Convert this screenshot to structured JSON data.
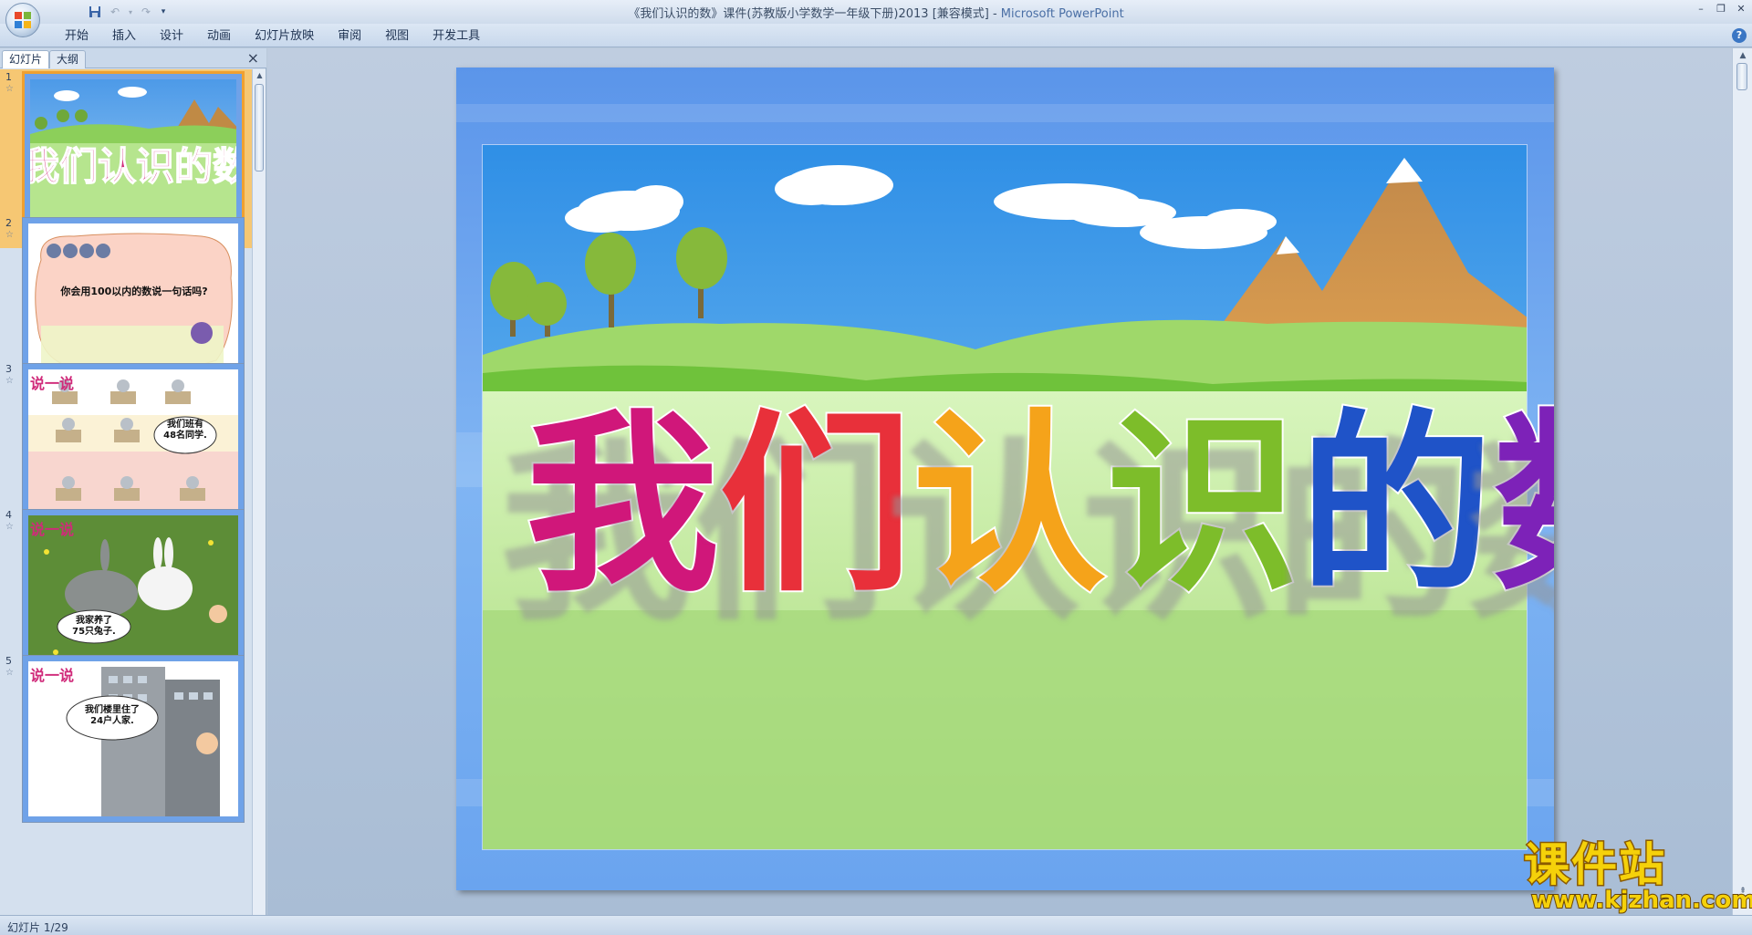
{
  "window": {
    "title": "《我们认识的数》课件(苏教版小学数学一年级下册)2013 [兼容模式] - ",
    "app_name": "Microsoft PowerPoint"
  },
  "quick_access": {
    "save_icon": "save-icon",
    "undo_icon": "undo-icon",
    "redo_icon": "redo-icon",
    "customize_icon": "dropdown-icon"
  },
  "ribbon": {
    "tabs": [
      "开始",
      "插入",
      "设计",
      "动画",
      "幻灯片放映",
      "审阅",
      "视图",
      "开发工具"
    ]
  },
  "left_panel": {
    "tabs": [
      "幻灯片",
      "大纲"
    ],
    "close_glyph": "×"
  },
  "thumbnails": [
    {
      "number": "1",
      "title": "我们认识的数"
    },
    {
      "number": "2",
      "text": "你会用100以内的数说一句话吗?"
    },
    {
      "number": "3",
      "header": "说一说",
      "bubble_line1": "我们班有",
      "bubble_line2": "48名同学."
    },
    {
      "number": "4",
      "header": "说一说",
      "bubble_line1": "我家养了",
      "bubble_line2": "75只兔子."
    },
    {
      "number": "5",
      "header": "说一说",
      "bubble_line1": "我们楼里住了",
      "bubble_line2": "24户人家."
    }
  ],
  "slide": {
    "title_chars": [
      "我",
      "们",
      "认",
      "识",
      "的",
      "数"
    ],
    "title_colors": [
      "#d0177a",
      "#e8303a",
      "#f5a31a",
      "#7dbd2a",
      "#1f53c8",
      "#7d22b8"
    ]
  },
  "watermark": {
    "chinese": "课件站",
    "url": "www.kjzhan.com"
  },
  "status_bar": {
    "text": "幻灯片 1/29"
  }
}
